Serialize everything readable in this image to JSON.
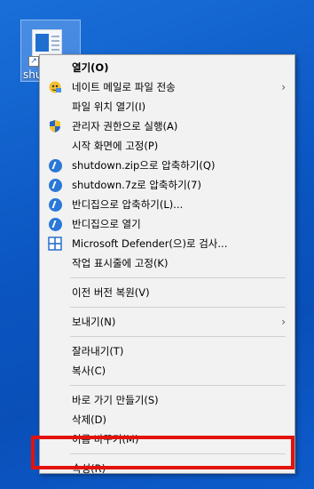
{
  "desktop": {
    "icon_label": "shu",
    "highlight_color": "#e3120b"
  },
  "menu": {
    "groups": [
      [
        {
          "label": "열기(O)",
          "bold": true,
          "icon": "none"
        },
        {
          "label": "네이트 메일로 파일 전송",
          "icon": "nate-mail-icon",
          "submenu": true
        },
        {
          "label": "파일 위치 열기(I)",
          "icon": "none"
        },
        {
          "label": "관리자 권한으로 실행(A)",
          "icon": "uac-shield-icon"
        },
        {
          "label": "시작 화면에 고정(P)",
          "icon": "none"
        },
        {
          "label": "shutdown.zip으로 압축하기(Q)",
          "icon": "bandizip-icon"
        },
        {
          "label": "shutdown.7z로 압축하기(7)",
          "icon": "bandizip-icon"
        },
        {
          "label": "반디집으로 압축하기(L)...",
          "icon": "bandizip-icon"
        },
        {
          "label": "반디집으로 열기",
          "icon": "bandizip-icon"
        },
        {
          "label": "Microsoft Defender(으)로 검사...",
          "icon": "defender-icon"
        },
        {
          "label": "작업 표시줄에 고정(K)",
          "icon": "none"
        }
      ],
      [
        {
          "label": "이전 버전 복원(V)",
          "icon": "none"
        }
      ],
      [
        {
          "label": "보내기(N)",
          "icon": "none",
          "submenu": true
        }
      ],
      [
        {
          "label": "잘라내기(T)",
          "icon": "none"
        },
        {
          "label": "복사(C)",
          "icon": "none"
        }
      ],
      [
        {
          "label": "바로 가기 만들기(S)",
          "icon": "none"
        },
        {
          "label": "삭제(D)",
          "icon": "none"
        },
        {
          "label": "이름 바꾸기(M)",
          "icon": "none"
        }
      ],
      [
        {
          "label": "속성(R)",
          "icon": "none"
        }
      ]
    ]
  }
}
